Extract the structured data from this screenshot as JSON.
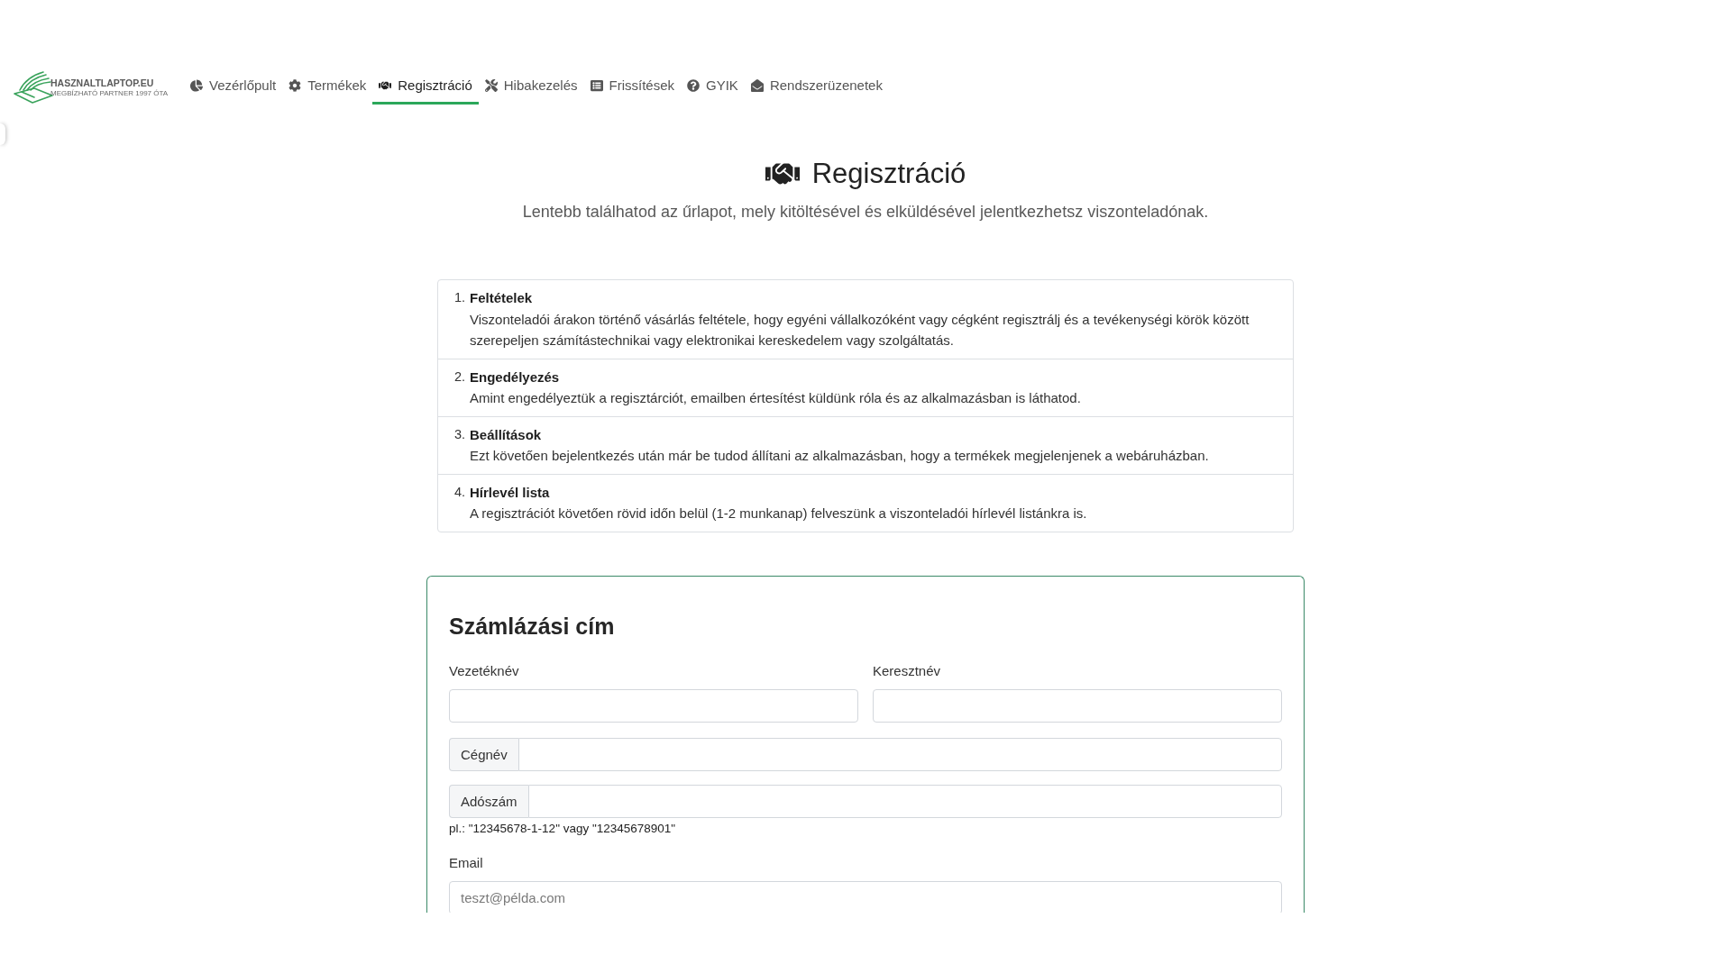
{
  "logo": {
    "name": "HASZNALTLAPTOP.EU",
    "tagline": "MEGBÍZHATÓ PARTNER 1997 ÓTA"
  },
  "nav": [
    {
      "label": "Vezérlőpult",
      "selected": false
    },
    {
      "label": "Termékek",
      "selected": false
    },
    {
      "label": "Regisztráció",
      "selected": true
    },
    {
      "label": "Hibakezelés",
      "selected": false
    },
    {
      "label": "Frissítések",
      "selected": false
    },
    {
      "label": "GYIK",
      "selected": false
    },
    {
      "label": "Rendszerüzenetek",
      "selected": false
    }
  ],
  "page_header": {
    "title": "Regisztráció",
    "subtitle": "Lentebb találhatod az űrlapot, mely kitöltésével és elküldésével jelentkezhetsz viszonteladónak."
  },
  "steps": [
    {
      "number": "1.",
      "title": "Feltételek",
      "text": "Viszonteladói árakon történő vásárlás feltétele, hogy egyéni vállalkozóként vagy cégként regisztrálj és a tevékenységi körök között szerepeljen számítástechnikai vagy elektronikai kereskedelem vagy szolgáltatás."
    },
    {
      "number": "2.",
      "title": "Engedélyezés",
      "text": "Amint engedélyeztük a regisztárciót, emailben értesítést küldünk róla és az alkalmazásban is láthatod."
    },
    {
      "number": "3.",
      "title": "Beállítások",
      "text": "Ezt követően bejelentkezés után már be tudod állítani az alkalmazásban, hogy a termékek megjelenjenek a webáruházban."
    },
    {
      "number": "4.",
      "title": "Hírlevél lista",
      "text": "A regisztrációt követően rövid időn belül (1-2 munkanap) felveszünk a viszonteladói hírlevél listánkra is."
    }
  ],
  "billing_form": {
    "title": "Számlázási cím",
    "name_fields": [
      {
        "label": "Vezetéknév"
      },
      {
        "label": "Keresztnév"
      }
    ],
    "addon_fields": [
      {
        "addon": "Cégnév"
      },
      {
        "addon": "Adószám",
        "hint": "pl.: \"12345678-1-12\" vagy \"12345678901\""
      }
    ],
    "email": {
      "label": "Email",
      "placeholder": "teszt@példa.com"
    }
  }
}
